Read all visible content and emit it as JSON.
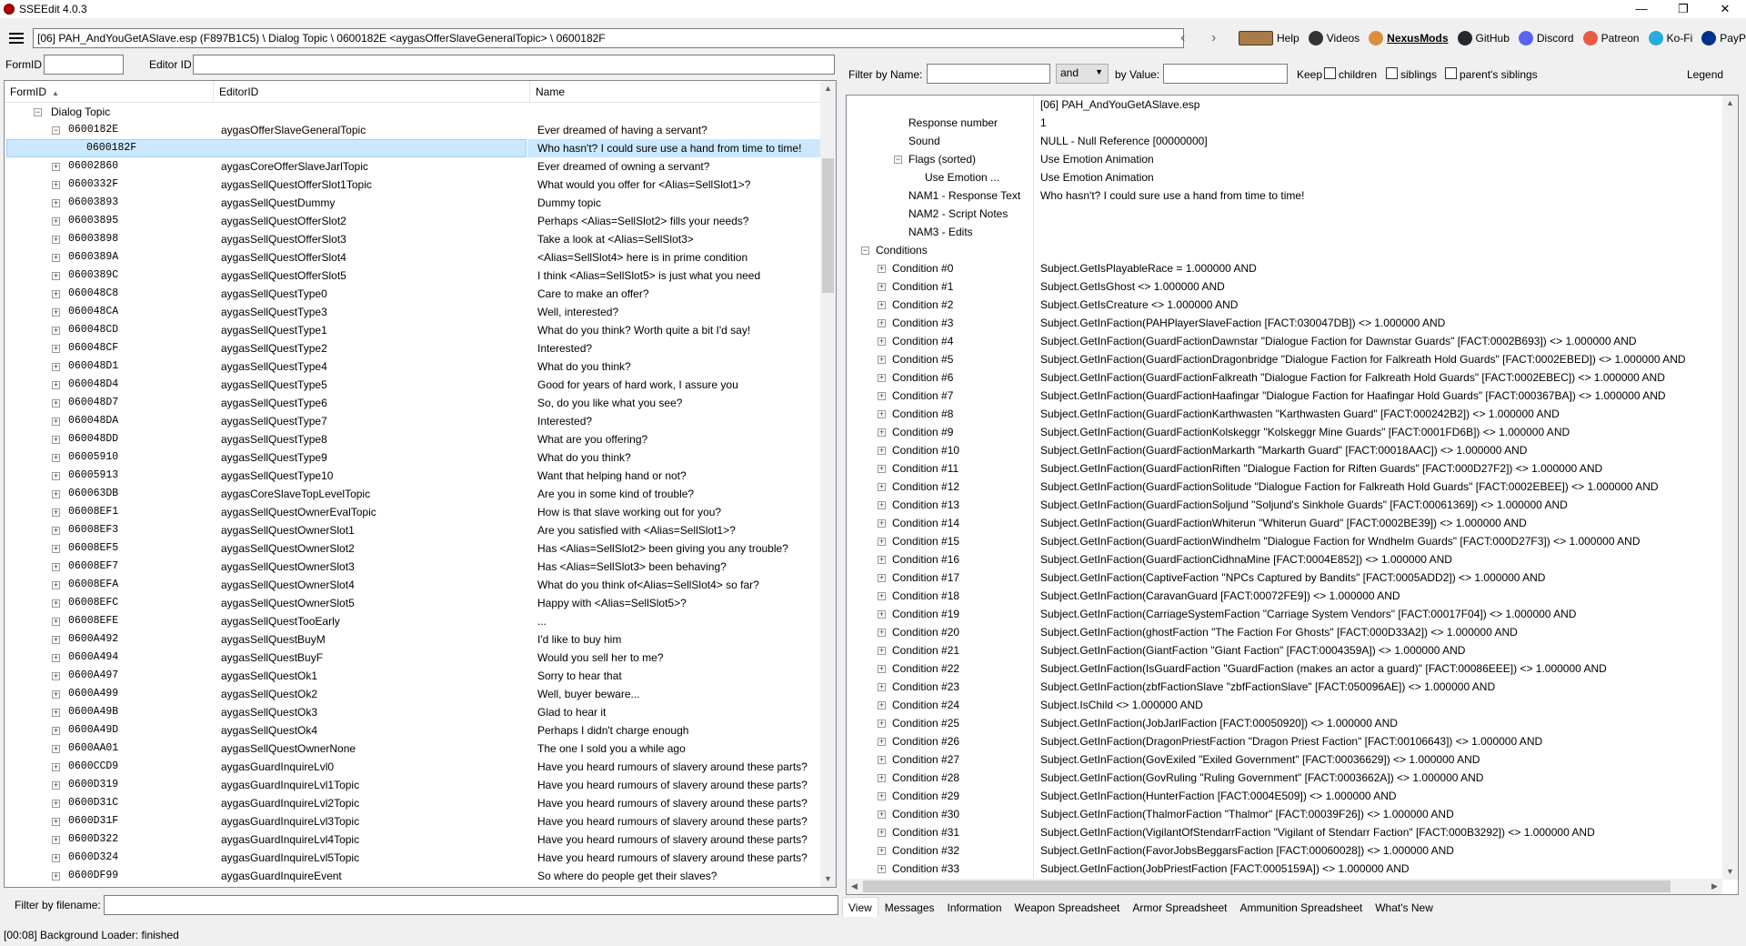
{
  "window": {
    "title": "SSEEdit 4.0.3",
    "controls": {
      "minimize": "—",
      "maximize": "❐",
      "close": "✕"
    }
  },
  "toolbar": {
    "path": "[06] PAH_AndYouGetASlave.esp (F897B1C5) \\ Dialog Topic \\ 0600182E <aygasOfferSlaveGeneralTopic> \\ 0600182F",
    "links": [
      {
        "label": "Help",
        "icon": "book-icon",
        "color": "#a87a4a"
      },
      {
        "label": "Videos",
        "icon": "videos-icon",
        "color": "#333333"
      },
      {
        "label": "NexusMods",
        "icon": "nexusmods-icon",
        "color": "#d98f40"
      },
      {
        "label": "GitHub",
        "icon": "github-icon",
        "color": "#24292e"
      },
      {
        "label": "Discord",
        "icon": "discord-icon",
        "color": "#5865f2"
      },
      {
        "label": "Patreon",
        "icon": "patreon-icon",
        "color": "#e85b46"
      },
      {
        "label": "Ko-Fi",
        "icon": "kofi-icon",
        "color": "#29abe0"
      },
      {
        "label": "PayPal",
        "icon": "paypal-icon",
        "color": "#003087"
      }
    ]
  },
  "left": {
    "formid_label": "FormID",
    "editorid_label": "Editor ID",
    "formid_value": "",
    "editorid_value": "",
    "columns": {
      "formid": "FormID",
      "editorid": "EditorID",
      "name": "Name"
    },
    "root_label": "Dialog Topic",
    "rows": [
      {
        "formid": "0600182E",
        "editorid": "aygasOfferSlaveGeneralTopic",
        "name": "Ever dreamed of having a servant?",
        "expanded": true
      },
      {
        "formid": "0600182F",
        "editorid": "",
        "name": "Who hasn't?  I could sure use a hand from time to time!",
        "child": true,
        "selected": true
      },
      {
        "formid": "06002860",
        "editorid": "aygasCoreOfferSlaveJarlTopic",
        "name": "Ever dreamed of owning a servant?"
      },
      {
        "formid": "0600332F",
        "editorid": "aygasSellQuestOfferSlot1Topic",
        "name": "What would you offer for <Alias=SellSlot1>?"
      },
      {
        "formid": "06003893",
        "editorid": "aygasSellQuestDummy",
        "name": "Dummy topic"
      },
      {
        "formid": "06003895",
        "editorid": "aygasSellQuestOfferSlot2",
        "name": "Perhaps <Alias=SellSlot2> fills your needs?"
      },
      {
        "formid": "06003898",
        "editorid": "aygasSellQuestOfferSlot3",
        "name": "Take a look at <Alias=SellSlot3>"
      },
      {
        "formid": "0600389A",
        "editorid": "aygasSellQuestOfferSlot4",
        "name": "<Alias=SellSlot4> here is in prime condition"
      },
      {
        "formid": "0600389C",
        "editorid": "aygasSellQuestOfferSlot5",
        "name": "I think <Alias=SellSlot5> is just what you need"
      },
      {
        "formid": "060048C8",
        "editorid": "aygasSellQuestType0",
        "name": "Care to make an offer?"
      },
      {
        "formid": "060048CA",
        "editorid": "aygasSellQuestType3",
        "name": "Well, interested?"
      },
      {
        "formid": "060048CD",
        "editorid": "aygasSellQuestType1",
        "name": "What do you think?  Worth quite a bit I'd say!"
      },
      {
        "formid": "060048CF",
        "editorid": "aygasSellQuestType2",
        "name": "Interested?"
      },
      {
        "formid": "060048D1",
        "editorid": "aygasSellQuestType4",
        "name": "What do you think?"
      },
      {
        "formid": "060048D4",
        "editorid": "aygasSellQuestType5",
        "name": "Good for years of hard work, I assure you"
      },
      {
        "formid": "060048D7",
        "editorid": "aygasSellQuestType6",
        "name": "So, do you like what you see?"
      },
      {
        "formid": "060048DA",
        "editorid": "aygasSellQuestType7",
        "name": "Interested?"
      },
      {
        "formid": "060048DD",
        "editorid": "aygasSellQuestType8",
        "name": "What are you offering?"
      },
      {
        "formid": "06005910",
        "editorid": "aygasSellQuestType9",
        "name": "What do you think?"
      },
      {
        "formid": "06005913",
        "editorid": "aygasSellQuestType10",
        "name": "Want that helping hand or not?"
      },
      {
        "formid": "060063DB",
        "editorid": "aygasCoreSlaveTopLevelTopic",
        "name": "Are you in some kind of trouble?"
      },
      {
        "formid": "06008EF1",
        "editorid": "aygasSellQuestOwnerEvalTopic",
        "name": "How is that slave working out for you?"
      },
      {
        "formid": "06008EF3",
        "editorid": "aygasSellQuestOwnerSlot1",
        "name": "Are you satisfied with <Alias=SellSlot1>?"
      },
      {
        "formid": "06008EF5",
        "editorid": "aygasSellQuestOwnerSlot2",
        "name": "Has <Alias=SellSlot2> been giving you any trouble?"
      },
      {
        "formid": "06008EF7",
        "editorid": "aygasSellQuestOwnerSlot3",
        "name": "Has <Alias=SellSlot3> been behaving?"
      },
      {
        "formid": "06008EFA",
        "editorid": "aygasSellQuestOwnerSlot4",
        "name": "What do you think of<Alias=SellSlot4> so far?"
      },
      {
        "formid": "06008EFC",
        "editorid": "aygasSellQuestOwnerSlot5",
        "name": "Happy with <Alias=SellSlot5>?"
      },
      {
        "formid": "06008EFE",
        "editorid": "aygasSellQuestTooEarly",
        "name": "..."
      },
      {
        "formid": "0600A492",
        "editorid": "aygasSellQuestBuyM",
        "name": "I'd like to buy him"
      },
      {
        "formid": "0600A494",
        "editorid": "aygasSellQuestBuyF",
        "name": "Would you sell her to me?"
      },
      {
        "formid": "0600A497",
        "editorid": "aygasSellQuestOk1",
        "name": "Sorry to hear that"
      },
      {
        "formid": "0600A499",
        "editorid": "aygasSellQuestOk2",
        "name": "Well, buyer beware..."
      },
      {
        "formid": "0600A49B",
        "editorid": "aygasSellQuestOk3",
        "name": "Glad to hear it"
      },
      {
        "formid": "0600A49D",
        "editorid": "aygasSellQuestOk4",
        "name": "Perhaps I didn't charge enough"
      },
      {
        "formid": "0600AA01",
        "editorid": "aygasSellQuestOwnerNone",
        "name": "The one I sold you a while ago"
      },
      {
        "formid": "0600CCD9",
        "editorid": "aygasGuardInquireLvl0",
        "name": "Have you heard rumours of slavery around these parts?"
      },
      {
        "formid": "0600D319",
        "editorid": "aygasGuardInquireLvl1Topic",
        "name": "Have you heard rumours of slavery around these parts?"
      },
      {
        "formid": "0600D31C",
        "editorid": "aygasGuardInquireLvl2Topic",
        "name": "Have you heard rumours of slavery around these parts?"
      },
      {
        "formid": "0600D31F",
        "editorid": "aygasGuardInquireLvl3Topic",
        "name": "Have you heard rumours of slavery around these parts?"
      },
      {
        "formid": "0600D322",
        "editorid": "aygasGuardInquireLvl4Topic",
        "name": "Have you heard rumours of slavery around these parts?"
      },
      {
        "formid": "0600D324",
        "editorid": "aygasGuardInquireLvl5Topic",
        "name": "Have you heard rumours of slavery around these parts?"
      },
      {
        "formid": "0600DF99",
        "editorid": "aygasGuardInquireEvent",
        "name": "So where do people get their slaves?"
      }
    ],
    "filter_label": "Filter by filename:",
    "filter_value": ""
  },
  "right": {
    "filter_name_label": "Filter by Name:",
    "name_value": "",
    "op_value": "and",
    "filter_value_label": "by Value:",
    "value_value": "",
    "keep_label": "Keep",
    "children_label": "children",
    "siblings_label": "siblings",
    "parents_siblings_label": "parent's siblings",
    "legend_label": "Legend",
    "rows": [
      {
        "label": "",
        "value": "[06] PAH_AndYouGetASlave.esp",
        "indent": 0
      },
      {
        "label": "Response number",
        "value": "1",
        "indent": 2
      },
      {
        "label": "Sound",
        "value": "NULL - Null Reference [00000000]",
        "indent": 2
      },
      {
        "label": "Flags (sorted)",
        "value": "Use Emotion Animation",
        "indent": 2,
        "expander": "minus"
      },
      {
        "label": "Use Emotion ...",
        "value": "Use Emotion Animation",
        "indent": 3
      },
      {
        "label": "NAM1 - Response Text",
        "value": "Who hasn't?  I could sure use a hand from time to time!",
        "indent": 2
      },
      {
        "label": "NAM2 - Script Notes",
        "value": "",
        "indent": 2
      },
      {
        "label": "NAM3 - Edits",
        "value": "",
        "indent": 2
      },
      {
        "label": "Conditions",
        "value": "",
        "indent": 0,
        "expander": "minus"
      },
      {
        "label": "Condition #0",
        "value": "Subject.GetIsPlayableRace = 1.000000 AND",
        "indent": 1,
        "expander": "plus"
      },
      {
        "label": "Condition #1",
        "value": "Subject.GetIsGhost <> 1.000000 AND",
        "indent": 1,
        "expander": "plus"
      },
      {
        "label": "Condition #2",
        "value": "Subject.GetIsCreature <> 1.000000 AND",
        "indent": 1,
        "expander": "plus"
      },
      {
        "label": "Condition #3",
        "value": "Subject.GetInFaction(PAHPlayerSlaveFaction [FACT:030047DB]) <> 1.000000 AND",
        "indent": 1,
        "expander": "plus"
      },
      {
        "label": "Condition #4",
        "value": "Subject.GetInFaction(GuardFactionDawnstar \"Dialogue Faction for Dawnstar Guards\" [FACT:0002B693]) <> 1.000000 AND",
        "indent": 1,
        "expander": "plus"
      },
      {
        "label": "Condition #5",
        "value": "Subject.GetInFaction(GuardFactionDragonbridge \"Dialogue Faction for Falkreath Hold Guards\" [FACT:0002EBED]) <> 1.000000 AND",
        "indent": 1,
        "expander": "plus"
      },
      {
        "label": "Condition #6",
        "value": "Subject.GetInFaction(GuardFactionFalkreath \"Dialogue Faction for Falkreath Hold Guards\" [FACT:0002EBEC]) <> 1.000000 AND",
        "indent": 1,
        "expander": "plus"
      },
      {
        "label": "Condition #7",
        "value": "Subject.GetInFaction(GuardFactionHaafingar \"Dialogue Faction for Haafingar Hold Guards\" [FACT:000367BA]) <> 1.000000 AND",
        "indent": 1,
        "expander": "plus"
      },
      {
        "label": "Condition #8",
        "value": "Subject.GetInFaction(GuardFactionKarthwasten \"Karthwasten Guard\" [FACT:000242B2]) <> 1.000000 AND",
        "indent": 1,
        "expander": "plus"
      },
      {
        "label": "Condition #9",
        "value": "Subject.GetInFaction(GuardFactionKolskeggr \"Kolskeggr Mine Guards\" [FACT:0001FD6B]) <> 1.000000 AND",
        "indent": 1,
        "expander": "plus"
      },
      {
        "label": "Condition #10",
        "value": "Subject.GetInFaction(GuardFactionMarkarth \"Markarth Guard\" [FACT:00018AAC]) <> 1.000000 AND",
        "indent": 1,
        "expander": "plus"
      },
      {
        "label": "Condition #11",
        "value": "Subject.GetInFaction(GuardFactionRiften \"Dialogue Faction for Riften Guards\" [FACT:000D27F2]) <> 1.000000 AND",
        "indent": 1,
        "expander": "plus"
      },
      {
        "label": "Condition #12",
        "value": "Subject.GetInFaction(GuardFactionSolitude \"Dialogue Faction for Falkreath Hold Guards\" [FACT:0002EBEE]) <> 1.000000 AND",
        "indent": 1,
        "expander": "plus"
      },
      {
        "label": "Condition #13",
        "value": "Subject.GetInFaction(GuardFactionSoljund \"Soljund's Sinkhole Guards\" [FACT:00061369]) <> 1.000000 AND",
        "indent": 1,
        "expander": "plus"
      },
      {
        "label": "Condition #14",
        "value": "Subject.GetInFaction(GuardFactionWhiterun \"Whiterun Guard\" [FACT:0002BE39]) <> 1.000000 AND",
        "indent": 1,
        "expander": "plus"
      },
      {
        "label": "Condition #15",
        "value": "Subject.GetInFaction(GuardFactionWindhelm \"Dialogue Faction for Wndhelm Guards\" [FACT:000D27F3]) <> 1.000000 AND",
        "indent": 1,
        "expander": "plus"
      },
      {
        "label": "Condition #16",
        "value": "Subject.GetInFaction(GuardFactionCidhnaMine [FACT:0004E852]) <> 1.000000 AND",
        "indent": 1,
        "expander": "plus"
      },
      {
        "label": "Condition #17",
        "value": "Subject.GetInFaction(CaptiveFaction \"NPCs Captured by Bandits\" [FACT:0005ADD2]) <> 1.000000 AND",
        "indent": 1,
        "expander": "plus"
      },
      {
        "label": "Condition #18",
        "value": "Subject.GetInFaction(CaravanGuard [FACT:00072FE9]) <> 1.000000 AND",
        "indent": 1,
        "expander": "plus"
      },
      {
        "label": "Condition #19",
        "value": "Subject.GetInFaction(CarriageSystemFaction \"Carriage System Vendors\" [FACT:00017F04]) <> 1.000000 AND",
        "indent": 1,
        "expander": "plus"
      },
      {
        "label": "Condition #20",
        "value": "Subject.GetInFaction(ghostFaction \"The Faction For Ghosts\" [FACT:000D33A2]) <> 1.000000 AND",
        "indent": 1,
        "expander": "plus"
      },
      {
        "label": "Condition #21",
        "value": "Subject.GetInFaction(GiantFaction \"Giant Faction\" [FACT:0004359A]) <> 1.000000 AND",
        "indent": 1,
        "expander": "plus"
      },
      {
        "label": "Condition #22",
        "value": "Subject.GetInFaction(IsGuardFaction \"GuardFaction (makes an actor a guard)\" [FACT:00086EEE]) <> 1.000000 AND",
        "indent": 1,
        "expander": "plus"
      },
      {
        "label": "Condition #23",
        "value": "Subject.GetInFaction(zbfFactionSlave \"zbfFactionSlave\" [FACT:050096AE]) <> 1.000000 AND",
        "indent": 1,
        "expander": "plus"
      },
      {
        "label": "Condition #24",
        "value": "Subject.IsChild <> 1.000000 AND",
        "indent": 1,
        "expander": "plus"
      },
      {
        "label": "Condition #25",
        "value": "Subject.GetInFaction(JobJarlFaction [FACT:00050920]) <> 1.000000 AND",
        "indent": 1,
        "expander": "plus"
      },
      {
        "label": "Condition #26",
        "value": "Subject.GetInFaction(DragonPriestFaction \"Dragon Priest Faction\" [FACT:00106643]) <> 1.000000 AND",
        "indent": 1,
        "expander": "plus"
      },
      {
        "label": "Condition #27",
        "value": "Subject.GetInFaction(GovExiled \"Exiled Government\" [FACT:00036629]) <> 1.000000 AND",
        "indent": 1,
        "expander": "plus"
      },
      {
        "label": "Condition #28",
        "value": "Subject.GetInFaction(GovRuling \"Ruling Government\" [FACT:0003662A]) <> 1.000000 AND",
        "indent": 1,
        "expander": "plus"
      },
      {
        "label": "Condition #29",
        "value": "Subject.GetInFaction(HunterFaction [FACT:0004E509]) <> 1.000000 AND",
        "indent": 1,
        "expander": "plus"
      },
      {
        "label": "Condition #30",
        "value": "Subject.GetInFaction(ThalmorFaction \"Thalmor\" [FACT:00039F26]) <> 1.000000 AND",
        "indent": 1,
        "expander": "plus"
      },
      {
        "label": "Condition #31",
        "value": "Subject.GetInFaction(VigilantOfStendarrFaction \"Vigilant of Stendarr Faction\" [FACT:000B3292]) <> 1.000000 AND",
        "indent": 1,
        "expander": "plus"
      },
      {
        "label": "Condition #32",
        "value": "Subject.GetInFaction(FavorJobsBeggarsFaction [FACT:00060028]) <> 1.000000 AND",
        "indent": 1,
        "expander": "plus"
      },
      {
        "label": "Condition #33",
        "value": "Subject.GetInFaction(JobPriestFaction [FACT:0005159A]) <> 1.000000 AND",
        "indent": 1,
        "expander": "plus"
      }
    ],
    "tabs": [
      "View",
      "Messages",
      "Information",
      "Weapon Spreadsheet",
      "Armor Spreadsheet",
      "Ammunition Spreadsheet",
      "What's New"
    ]
  },
  "status": "[00:08] Background Loader: finished"
}
